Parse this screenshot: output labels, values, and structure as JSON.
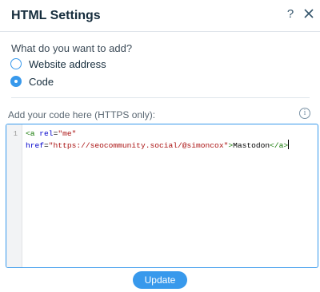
{
  "dialog": {
    "title": "HTML Settings",
    "help_symbol": "?"
  },
  "add_type": {
    "question": "What do you want to add?",
    "options": [
      {
        "label": "Website address",
        "selected": false
      },
      {
        "label": "Code",
        "selected": true
      }
    ]
  },
  "code_section": {
    "label": "Add your code here (HTTPS only):",
    "info_symbol": "i"
  },
  "editor": {
    "line_number": "1",
    "tokens": {
      "open_tag": "<a",
      "space": " ",
      "attr_rel": "rel",
      "equals": "=",
      "val_rel": "\"me\"",
      "attr_href": "href",
      "val_href": "\"https://seocommunity.social/@simoncox\"",
      "gt": ">",
      "text": "Mastodon",
      "close_tag": "</a>"
    }
  },
  "footer": {
    "update_label": "Update"
  },
  "colors": {
    "accent": "#3899ec",
    "title": "#162d3d",
    "divider": "#dfe5eb"
  },
  "icons": {
    "help": "question-mark-icon",
    "close": "close-icon",
    "info": "info-icon"
  }
}
